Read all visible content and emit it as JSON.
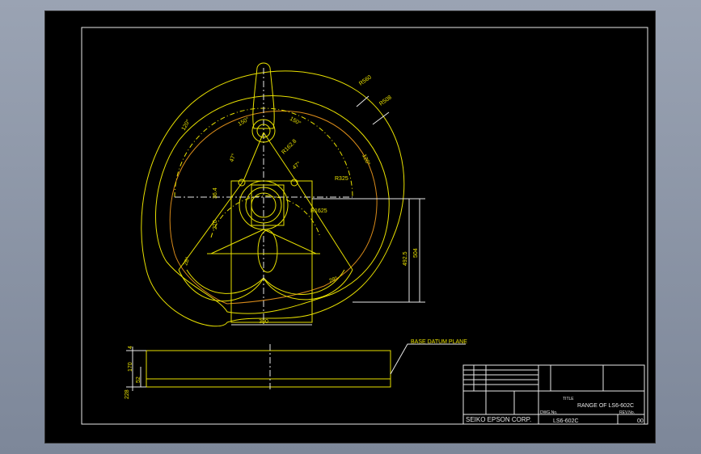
{
  "drawing": {
    "dimensions": {
      "r560": "R560",
      "r508": "R508",
      "a120_left": "120°",
      "a120_right": "120°",
      "a150_left": "150°",
      "a150_right": "150°",
      "a47_left": "47°",
      "a47_right": "47°",
      "r1628": "R162.8",
      "r325": "R325",
      "r1625": "R1625",
      "d364": "36.4",
      "d270": "270",
      "a28_left": "28°",
      "a28_right": "28°",
      "d4925": "492.5",
      "d504": "504",
      "d380": "380",
      "d4": "4",
      "d170": "170",
      "d52": "52",
      "d228": "228"
    },
    "base_label": "BASE DATUM PLANE"
  },
  "title_block": {
    "title_header": "TITLE",
    "title": "RANGE OF LS6-602C",
    "dwg_no_header": "DWG.No.",
    "dwg_no": "LS6-602C",
    "rev_header": "REV.No.",
    "rev": "00",
    "company": "SEIKO EPSON CORP."
  }
}
